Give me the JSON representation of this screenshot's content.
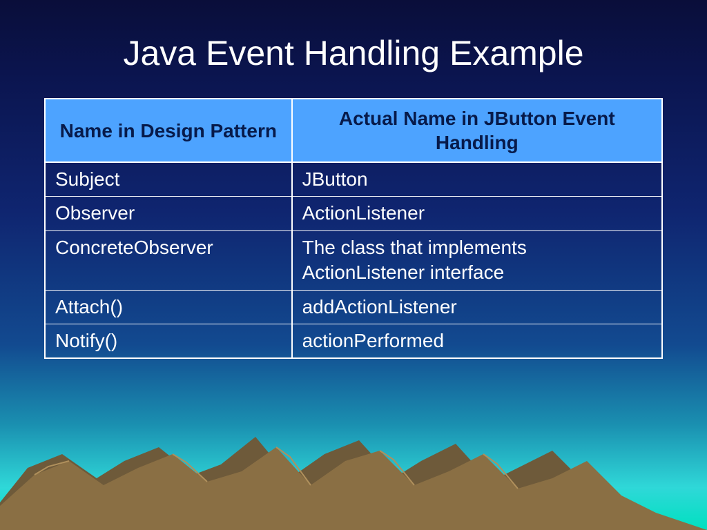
{
  "title": "Java Event Handling Example",
  "table": {
    "headers": {
      "col1": "Name in Design Pattern",
      "col2": "Actual Name in JButton Event Handling"
    },
    "rows": [
      {
        "col1": "Subject",
        "col2": "JButton"
      },
      {
        "col1": "Observer",
        "col2": "ActionListener"
      },
      {
        "col1": "ConcreteObserver",
        "col2": "The class that implements ActionListener interface"
      },
      {
        "col1": "Attach()",
        "col2": "addActionListener"
      },
      {
        "col1": "Notify()",
        "col2": "actionPerformed"
      }
    ]
  }
}
